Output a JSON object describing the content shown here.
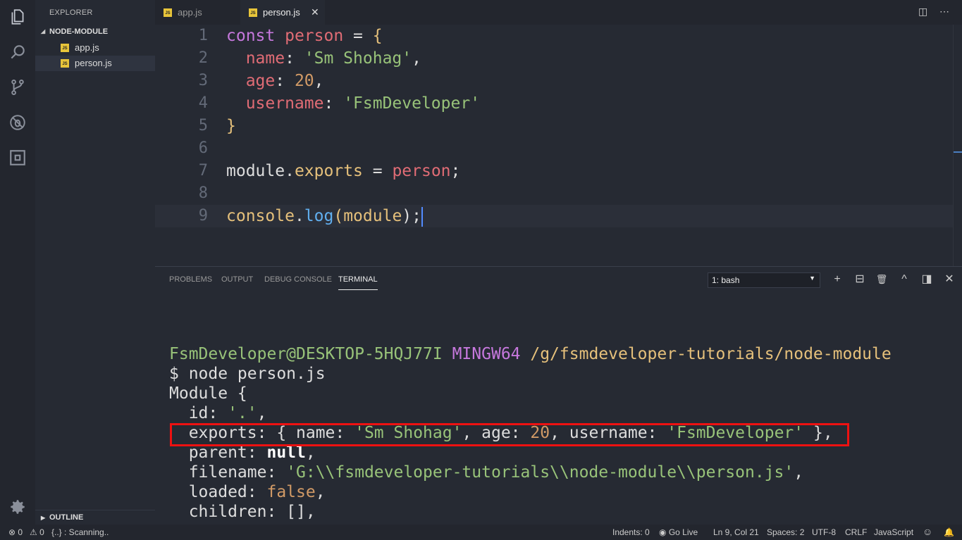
{
  "sidebar": {
    "title": "EXPLORER",
    "folder": "NODE-MODULE",
    "files": [
      {
        "name": "app.js",
        "badge": "JS"
      },
      {
        "name": "person.js",
        "badge": "JS"
      }
    ],
    "outline": "OUTLINE"
  },
  "tabs": [
    {
      "label": "app.js",
      "badge": "JS"
    },
    {
      "label": "person.js",
      "badge": "JS",
      "close": "✕"
    }
  ],
  "editor": {
    "line_numbers": [
      "1",
      "2",
      "3",
      "4",
      "5",
      "6",
      "7",
      "8",
      "9"
    ],
    "lines": [
      [
        {
          "t": "const ",
          "c": "kw"
        },
        {
          "t": "person",
          "c": "vr"
        },
        {
          "t": " = ",
          "c": "pn"
        },
        {
          "t": "{",
          "c": "fn"
        }
      ],
      [
        {
          "t": "  name",
          "c": "vr"
        },
        {
          "t": ": ",
          "c": "pn"
        },
        {
          "t": "'Sm Shohag'",
          "c": "str"
        },
        {
          "t": ",",
          "c": "pn"
        }
      ],
      [
        {
          "t": "  age",
          "c": "vr"
        },
        {
          "t": ": ",
          "c": "pn"
        },
        {
          "t": "20",
          "c": "num"
        },
        {
          "t": ",",
          "c": "pn"
        }
      ],
      [
        {
          "t": "  username",
          "c": "vr"
        },
        {
          "t": ": ",
          "c": "pn"
        },
        {
          "t": "'FsmDeveloper'",
          "c": "str"
        }
      ],
      [
        {
          "t": "}",
          "c": "fn"
        }
      ],
      [],
      [
        {
          "t": "module",
          "c": "pn"
        },
        {
          "t": ".",
          "c": "pn"
        },
        {
          "t": "exports",
          "c": "fn"
        },
        {
          "t": " = ",
          "c": "pn"
        },
        {
          "t": "person",
          "c": "vr"
        },
        {
          "t": ";",
          "c": "pn"
        }
      ],
      [],
      [
        {
          "t": "console",
          "c": "fn"
        },
        {
          "t": ".",
          "c": "pn"
        },
        {
          "t": "log",
          "c": "mt"
        },
        {
          "t": "(",
          "c": "fn"
        },
        {
          "t": "module",
          "c": "fn"
        },
        {
          "t": ");",
          "c": "pn"
        }
      ]
    ]
  },
  "panel": {
    "tabs": [
      "PROBLEMS",
      "OUTPUT",
      "DEBUG CONSOLE",
      "TERMINAL"
    ],
    "active_tab": "TERMINAL",
    "terminal_select": "1: bash",
    "icons": [
      "+",
      "⊟",
      "🗑",
      "^",
      "◨",
      "✕"
    ]
  },
  "terminal": {
    "lines": [
      [
        {
          "t": "FsmDeveloper@DESKTOP-5HQJ77I ",
          "c": "t-green"
        },
        {
          "t": "MINGW64 ",
          "c": "t-mag"
        },
        {
          "t": "/g/fsmdeveloper-tutorials/node-module",
          "c": "t-yel"
        }
      ],
      [
        {
          "t": "$ node person.js",
          "c": ""
        }
      ],
      [
        {
          "t": "Module {",
          "c": ""
        }
      ],
      [
        {
          "t": "  id: ",
          "c": ""
        },
        {
          "t": "'.'",
          "c": "t-green"
        },
        {
          "t": ",",
          "c": ""
        }
      ],
      [
        {
          "t": "  exports: { name: ",
          "c": ""
        },
        {
          "t": "'Sm Shohag'",
          "c": "t-green"
        },
        {
          "t": ", age: ",
          "c": ""
        },
        {
          "t": "20",
          "c": "t-num"
        },
        {
          "t": ", username: ",
          "c": ""
        },
        {
          "t": "'FsmDeveloper'",
          "c": "t-green"
        },
        {
          "t": " },",
          "c": ""
        }
      ],
      [
        {
          "t": "  parent: ",
          "c": ""
        },
        {
          "t": "null",
          "c": "t-bold"
        },
        {
          "t": ",",
          "c": ""
        }
      ],
      [
        {
          "t": "  filename: ",
          "c": ""
        },
        {
          "t": "'G:\\\\fsmdeveloper-tutorials\\\\node-module\\\\person.js'",
          "c": "t-green"
        },
        {
          "t": ",",
          "c": ""
        }
      ],
      [
        {
          "t": "  loaded: ",
          "c": ""
        },
        {
          "t": "false",
          "c": "t-num"
        },
        {
          "t": ",",
          "c": ""
        }
      ],
      [
        {
          "t": "  children: [],",
          "c": ""
        }
      ]
    ]
  },
  "status": {
    "errors": "⊗ 0",
    "warnings": "⚠ 0",
    "scanning": "{..} : Scanning..",
    "indents": "Indents: 0",
    "golive": "Go Live",
    "position": "Ln 9, Col 21",
    "spaces": "Spaces: 2",
    "encoding": "UTF-8",
    "eol": "CRLF",
    "language": "JavaScript"
  },
  "colors": {
    "accent": "#528bff",
    "highlight_box": "#ee1111"
  }
}
